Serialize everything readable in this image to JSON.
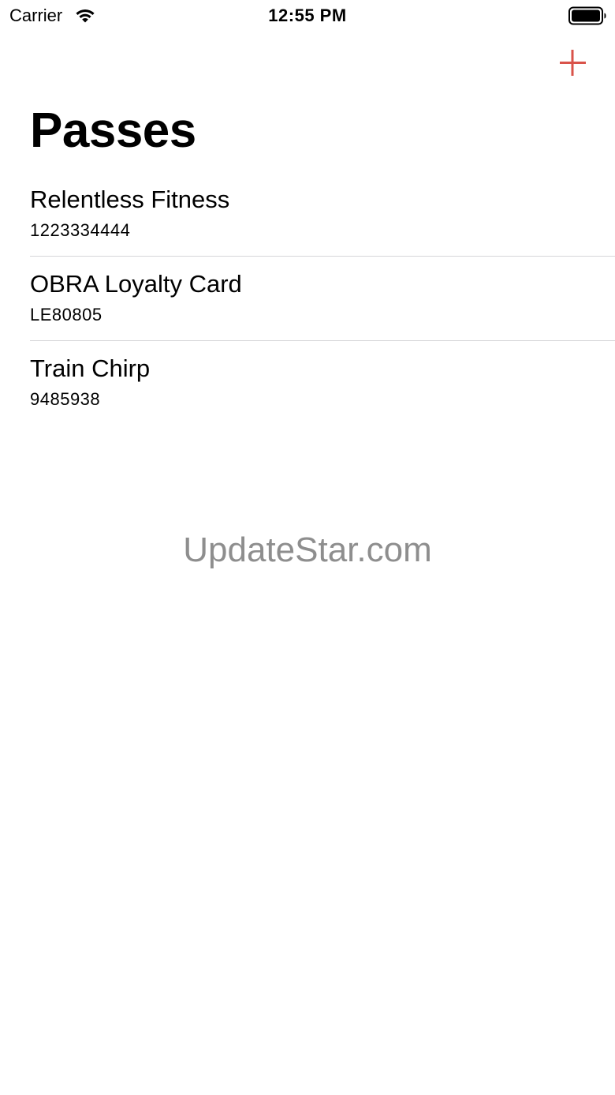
{
  "status_bar": {
    "carrier": "Carrier",
    "time": "12:55 PM",
    "wifi_icon": "wifi-icon",
    "battery_icon": "battery-full-icon"
  },
  "nav": {
    "add_icon": "plus-icon",
    "accent_color": "#d9534a"
  },
  "page": {
    "title": "Passes"
  },
  "passes": [
    {
      "name": "Relentless Fitness",
      "number": "1223334444"
    },
    {
      "name": "OBRA Loyalty Card",
      "number": "LE80805"
    },
    {
      "name": "Train Chirp",
      "number": "9485938"
    }
  ],
  "watermark": {
    "text": "UpdateStar.com"
  }
}
